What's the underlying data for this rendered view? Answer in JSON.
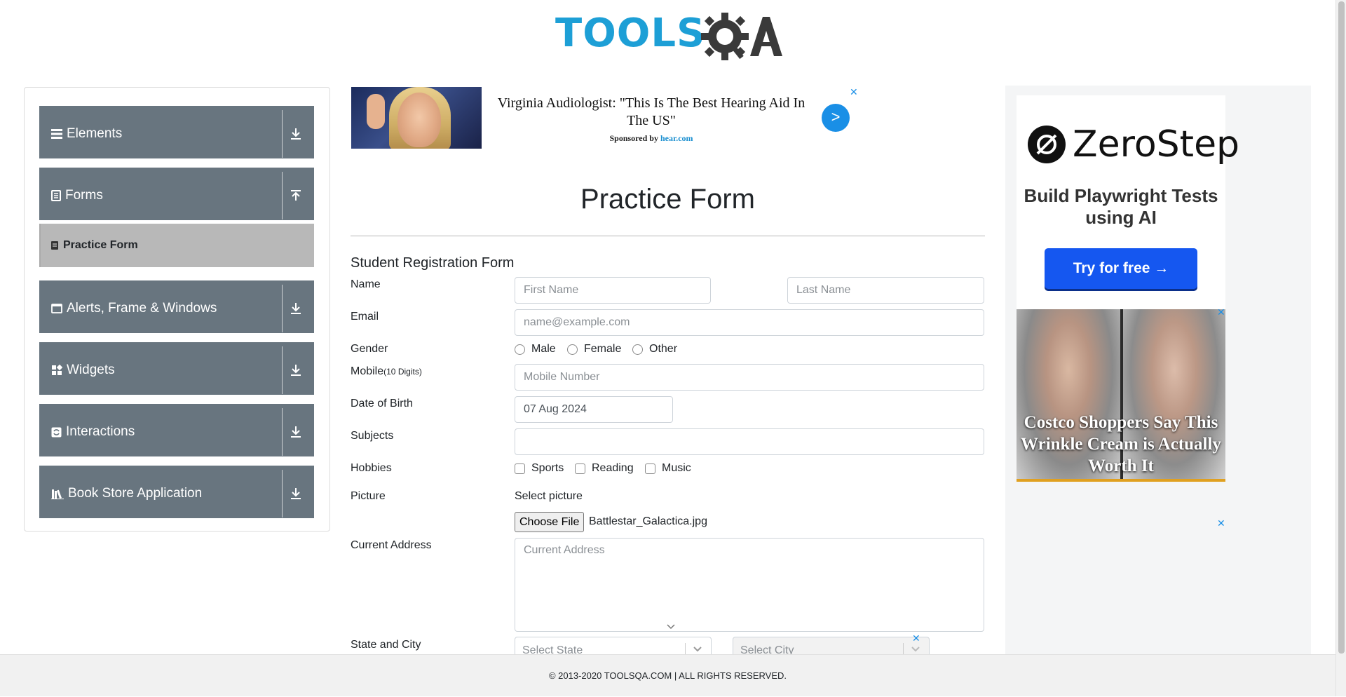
{
  "header": {
    "logo_text": "TOOLS",
    "logo_qa": "QA"
  },
  "sidebar": {
    "groups": [
      {
        "label": "Elements",
        "icon": "hamburger-icon"
      },
      {
        "label": "Forms",
        "icon": "document-icon"
      },
      {
        "label": "Alerts, Frame & Windows",
        "icon": "window-icon"
      },
      {
        "label": "Widgets",
        "icon": "widgets-icon"
      },
      {
        "label": "Interactions",
        "icon": "interactions-icon"
      },
      {
        "label": "Book Store Application",
        "icon": "books-icon"
      }
    ],
    "active_item": "Practice Form"
  },
  "ad_top": {
    "headline": "Virginia Audiologist: \"This Is The Best Hearing Aid In The US\"",
    "sponsor_prefix": "Sponsored by ",
    "sponsor_name": "hear.com",
    "go": ">",
    "close": "✕"
  },
  "form": {
    "page_title": "Practice Form",
    "subtitle": "Student Registration Form",
    "labels": {
      "name": "Name",
      "email": "Email",
      "gender": "Gender",
      "mobile": "Mobile",
      "mobile_hint": "(10 Digits)",
      "dob": "Date of Birth",
      "subjects": "Subjects",
      "hobbies": "Hobbies",
      "picture": "Picture",
      "select_picture": "Select picture",
      "address": "Current Address",
      "state_city": "State and City"
    },
    "placeholders": {
      "first_name": "First Name",
      "last_name": "Last Name",
      "email": "name@example.com",
      "mobile": "Mobile Number",
      "address": "Current Address",
      "state": "Select State",
      "city": "Select City"
    },
    "dob_value": "07 Aug 2024",
    "genders": [
      "Male",
      "Female",
      "Other"
    ],
    "hobbies": [
      "Sports",
      "Reading",
      "Music"
    ],
    "file_button": "Choose File",
    "file_name": "Battlestar_Galactica.jpg"
  },
  "ad_right": {
    "brand": "ZeroStep",
    "tagline": "Build Playwright Tests using AI",
    "cta": "Try for free →",
    "costco_caption": "Costco Shoppers Say This Wrinkle Cream is Actually Worth It",
    "close": "✕"
  },
  "footer": {
    "text": "© 2013-2020 TOOLSQA.COM | ALL RIGHTS RESERVED."
  }
}
